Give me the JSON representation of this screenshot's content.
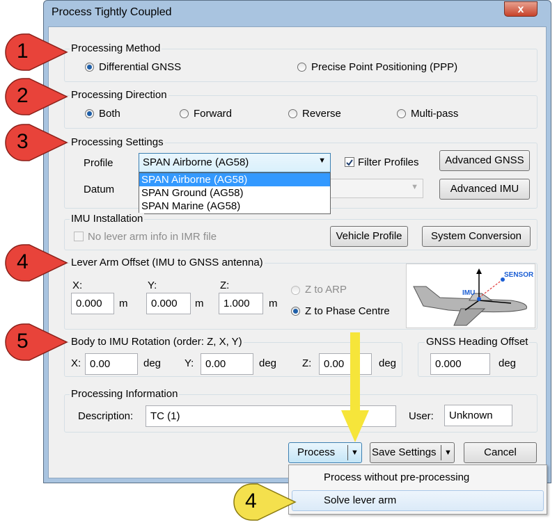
{
  "window": {
    "title": "Process Tightly Coupled",
    "close_glyph": "x"
  },
  "method": {
    "label": "Processing Method",
    "options": [
      "Differential GNSS",
      "Precise Point Positioning (PPP)"
    ],
    "selected": 0
  },
  "direction": {
    "label": "Processing Direction",
    "options": [
      "Both",
      "Forward",
      "Reverse",
      "Multi-pass"
    ],
    "selected": 0
  },
  "settings": {
    "label": "Processing Settings",
    "profile_label": "Profile",
    "profile_value": "SPAN Airborne (AG58)",
    "profile_options": [
      "SPAN Airborne (AG58)",
      "SPAN Ground (AG58)",
      "SPAN Marine (AG58)"
    ],
    "filter_profiles": "Filter Profiles",
    "filter_checked": true,
    "datum_label": "Datum",
    "advanced_gnss": "Advanced GNSS",
    "advanced_imu": "Advanced IMU"
  },
  "imu": {
    "label": "IMU Installation",
    "no_lever_arm": "No lever arm info in IMR file",
    "vehicle_profile": "Vehicle Profile",
    "system_conversion": "System Conversion"
  },
  "lever_arm": {
    "label": "Lever Arm Offset (IMU to GNSS antenna)",
    "x_label": "X:",
    "x_value": "0.000",
    "y_label": "Y:",
    "y_value": "0.000",
    "z_label": "Z:",
    "z_value": "1.000",
    "unit": "m",
    "z_to_arp": "Z to ARP",
    "z_to_phase": "Z to Phase Centre",
    "diagram": {
      "sensor": "SENSOR",
      "imu": "IMU"
    }
  },
  "rotation": {
    "label": "Body to IMU Rotation (order: Z, X, Y)",
    "x_label": "X:",
    "x_value": "0.00",
    "y_label": "Y:",
    "y_value": "0.00",
    "z_label": "Z:",
    "z_value": "0.00",
    "unit": "deg"
  },
  "heading": {
    "label": "GNSS Heading Offset",
    "value": "0.000",
    "unit": "deg"
  },
  "info": {
    "label": "Processing Information",
    "description_label": "Description:",
    "description_value": "TC (1)",
    "user_label": "User:",
    "user_value": "Unknown"
  },
  "buttons": {
    "process": "Process",
    "save_settings": "Save Settings",
    "cancel": "Cancel"
  },
  "process_menu": [
    "Process without pre-processing",
    "Solve lever arm"
  ],
  "markers": [
    "1",
    "2",
    "3",
    "4",
    "5",
    "4"
  ],
  "colors": {
    "marker_red": "#e8433a",
    "marker_yellow": "#f4e04d",
    "arrow_yellow": "#f6e53a",
    "selection_blue": "#3399ff"
  }
}
